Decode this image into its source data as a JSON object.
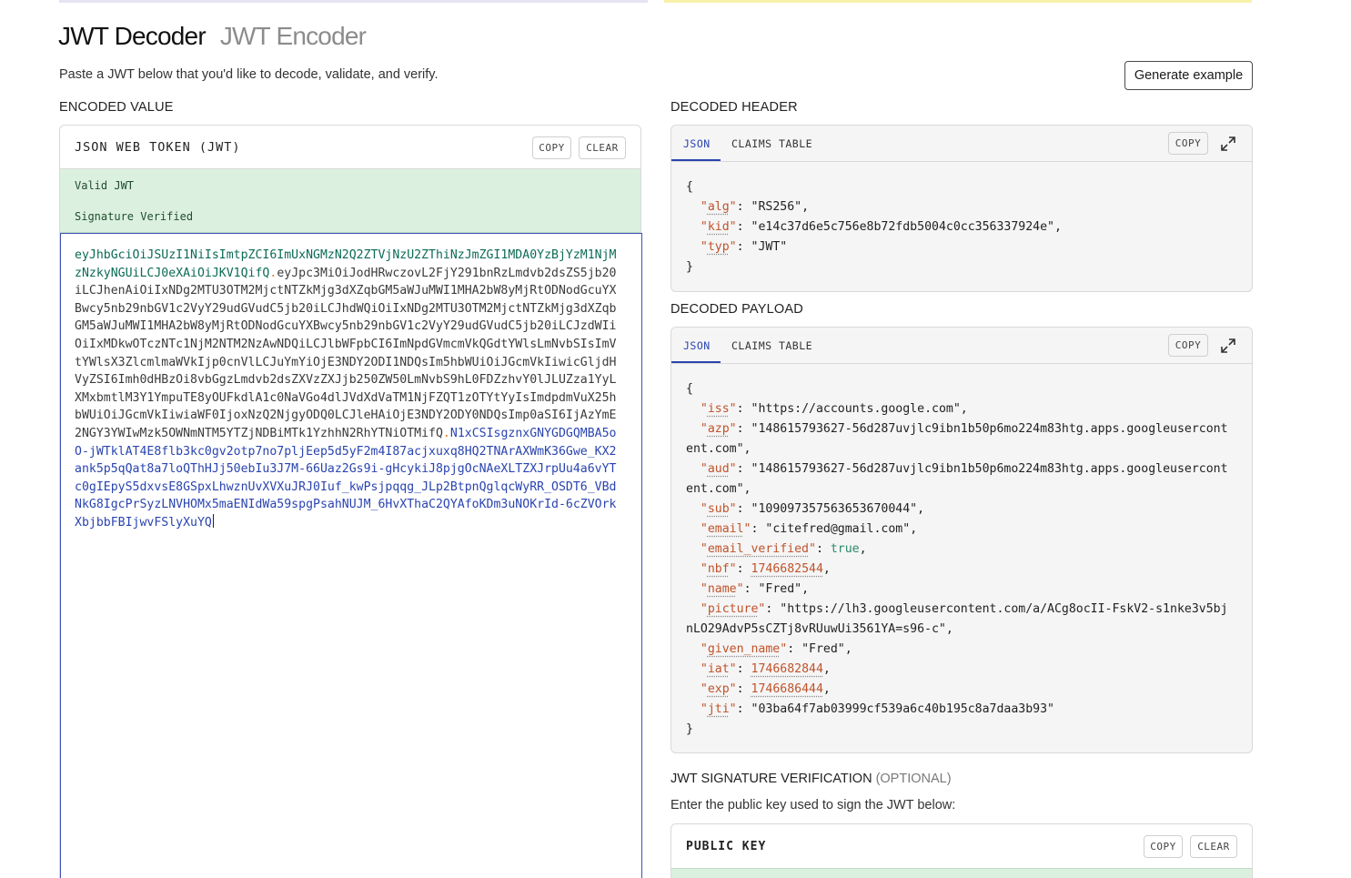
{
  "tabs": {
    "decoder": "JWT Decoder",
    "encoder": "JWT Encoder"
  },
  "subtitle": "Paste a JWT below that you'd like to decode, validate, and verify.",
  "generate_button": "Generate example",
  "encoded": {
    "section_label": "ENCODED VALUE",
    "panel_title": "JSON WEB TOKEN (JWT)",
    "copy": "COPY",
    "clear": "CLEAR",
    "status_valid": "Valid JWT",
    "status_signature": "Signature Verified",
    "token_header": "eyJhbGciOiJSUzI1NiIsImtpZCI6ImUxNGMzN2Q2ZTVjNzU2ZThiNzJmZGI1MDA0YzBjYzM1NjMzNzkyNGUiLCJ0eXAiOiJKV1QifQ",
    "token_payload": "eyJpc3MiOiJodHRwczovL2FjY291bnRzLmdvb2dsZS5jb20iLCJhenAiOiIxNDg2MTU3OTM2MjctNTZkMjg3dXZqbGM5aWJuMWI1MHA2bW8yMjRtODNodGcuYXBwcy5nb29nbGV1c2VyY29udGVudC5jb20iLCJhdWQiOiIxNDg2MTU3OTM2MjctNTZkMjg3dXZqbGM5aWJuMWI1MHA2bW8yMjRtODNodGcuYXBwcy5nb29nbGV1c2VyY29udGVudC5jb20iLCJzdWIiOiIxMDkwOTczNTc1NjM2NTM2NzAwNDQiLCJlbWFpbCI6ImNpdGVmcmVkQGdtYWlsLmNvbSIsImVtYWlsX3ZlcmlmaWVkIjp0cnVlLCJuYmYiOjE3NDY2ODI1NDQsIm5hbWUiOiJGcmVkIiwicGljdHVyZSI6Imh0dHBzOi8vbGgzLmdvb2dsZXVzZXJjb250ZW50LmNvbS9hL0FDZzhvY0lJLUZza1YyLXMxbmtlM3Y1YmpuTE8yOUFkdlA1c0NaVGo4dlJVdXdVaTM1NjFZQT1zOTYtYyIsImdpdmVuX25hbWUiOiJGcmVkIiwiaWF0IjoxNzQ2NjgyODQ0LCJleHAiOjE3NDY2ODY0NDQsImp0aSI6IjAzYmE2NGY3YWIwMzk5OWNmNTM5YTZjNDBiMTk1YzhhN2RhYTNiOTMifQ",
    "token_signature": "N1xCSIsgznxGNYGDGQMBA5oO-jWTklAT4E8flb3kc0gv2otp7no7pljEep5d5yF2m4I87acjxuxq8HQ2TNArAXWmK36Gwe_KX2ank5p5qQat8a7loQThHJj50ebIu3J7M-66Uaz2Gs9i-gHcykiJ8pjgOcNAeXLTZXJrpUu4a6vYTc0gIEpyS5dxvsE8GSpxLhwznUvXVXuJRJ0Iuf_kwPsjpqqg_JLp2BtpnQglqcWyRR_OSDT6_VBdNkG8IgcPrSyzLNVHOMx5maENIdWa59spgPsahNUJM_6HvXThaC2QYAfoKDm3uNOKrId-6cZVOrkXbjbbFBIjwvFSlyXuYQ"
  },
  "header": {
    "section_label": "DECODED HEADER",
    "tab_json": "JSON",
    "tab_claims": "CLAIMS TABLE",
    "copy": "COPY",
    "claims": [
      {
        "key": "alg",
        "value": "\"RS256\"",
        "type": "str"
      },
      {
        "key": "kid",
        "value": "\"e14c37d6e5c756e8b72fdb5004c0cc356337924e\"",
        "type": "str"
      },
      {
        "key": "typ",
        "value": "\"JWT\"",
        "type": "str"
      }
    ]
  },
  "payload": {
    "section_label": "DECODED PAYLOAD",
    "tab_json": "JSON",
    "tab_claims": "CLAIMS TABLE",
    "copy": "COPY",
    "claims": [
      {
        "key": "iss",
        "value": "\"https://accounts.google.com\"",
        "type": "str"
      },
      {
        "key": "azp",
        "value": "\"148615793627-56d287uvjlc9ibn1b50p6mo224m83htg.apps.googleusercontent.com\"",
        "type": "str"
      },
      {
        "key": "aud",
        "value": "\"148615793627-56d287uvjlc9ibn1b50p6mo224m83htg.apps.googleusercontent.com\"",
        "type": "str"
      },
      {
        "key": "sub",
        "value": "\"109097357563653670044\"",
        "type": "str"
      },
      {
        "key": "email",
        "value": "\"citefred@gmail.com\"",
        "type": "str"
      },
      {
        "key": "email_verified",
        "value": "true",
        "type": "bool"
      },
      {
        "key": "nbf",
        "value": "1746682544",
        "type": "num"
      },
      {
        "key": "name",
        "value": "\"Fred\"",
        "type": "str"
      },
      {
        "key": "picture",
        "value": "\"https://lh3.googleusercontent.com/a/ACg8ocII-FskV2-s1nke3v5bjnLO29AdvP5sCZTj8vRUuwUi3561YA=s96-c\"",
        "type": "str"
      },
      {
        "key": "given_name",
        "value": "\"Fred\"",
        "type": "str"
      },
      {
        "key": "iat",
        "value": "1746682844",
        "type": "num"
      },
      {
        "key": "exp",
        "value": "1746686444",
        "type": "num"
      },
      {
        "key": "jti",
        "value": "\"03ba64f7ab03999cf539a6c40b195c8a7daa3b93\"",
        "type": "str"
      }
    ]
  },
  "signature": {
    "section_label": "JWT SIGNATURE VERIFICATION",
    "optional": "(OPTIONAL)",
    "subtitle": "Enter the public key used to sign the JWT below:",
    "panel_title": "PUBLIC KEY",
    "copy": "COPY",
    "clear": "CLEAR"
  },
  "colors": {
    "accent": "#2a44b0",
    "valid_bg": "#dcf0e0",
    "key": "#c0532a"
  },
  "icons": {
    "expand": "expand-icon"
  }
}
